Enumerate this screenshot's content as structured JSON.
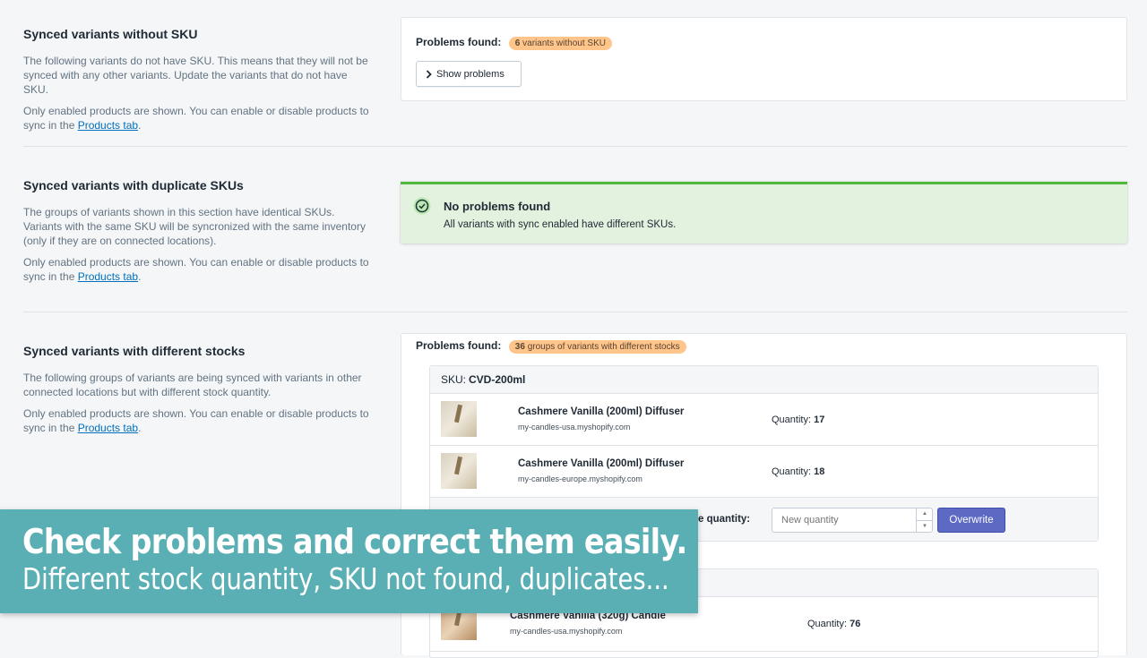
{
  "sections": [
    {
      "title": "Synced variants without SKU",
      "description": "The following variants do not have SKU. This means that they will not be synced with any other variants. Update the variants that do not have SKU.",
      "note_prefix": "Only enabled products are shown. You can enable or disable products to sync in the ",
      "link": "Products tab",
      "note_suffix": "."
    },
    {
      "title": "Synced variants with duplicate SKUs",
      "description": "The groups of variants shown in this section have identical SKUs. Variants with the same SKU will be syncronized with the same inventory (only if they are on connected locations).",
      "note_prefix": "Only enabled products are shown. You can enable or disable products to sync in the ",
      "link": "Products tab",
      "note_suffix": "."
    },
    {
      "title": "Synced variants with different stocks",
      "description": "The following groups of variants are being synced with variants in other connected locations but with different stock quantity.",
      "note_prefix": "Only enabled products are shown. You can enable or disable products to sync in the ",
      "link": "Products tab",
      "note_suffix": "."
    }
  ],
  "card_no_sku": {
    "problems_label": "Problems found:",
    "badge_count": "6",
    "badge_text": " variants without SKU",
    "button_label": "Show problems",
    "button_icon": "chevron-right-icon"
  },
  "card_duplicates": {
    "icon": "check-circle-icon",
    "title": "No problems found",
    "text": "All variants with sync enabled have different SKUs.",
    "color": "#50b83c"
  },
  "card_stocks": {
    "problems_label": "Problems found:",
    "badge_count": "36",
    "badge_text": " groups of variants with different stocks",
    "groups": [
      {
        "sku_label": "SKU: ",
        "sku": "CVD-200ml",
        "variants": [
          {
            "name": "Cashmere Vanilla (200ml) Diffuser",
            "store": "my-candles-usa.myshopify.com",
            "qty_label": "Quantity: ",
            "qty": "17"
          },
          {
            "name": "Cashmere Vanilla (200ml) Diffuser",
            "store": "my-candles-europe.myshopify.com",
            "qty_label": "Quantity: ",
            "qty": "18"
          }
        ],
        "overwrite_label": "e quantity:",
        "input_placeholder": "New quantity",
        "overwrite_button": "Overwrite"
      },
      {
        "variants": [
          {
            "name": "Cashmere Vanilla (320g) Candle",
            "store": "my-candles-usa.myshopify.com",
            "qty_label": "Quantity: ",
            "qty": "76"
          }
        ]
      }
    ]
  },
  "banner": {
    "headline": "Check problems and correct them easily.",
    "subline": "Different stock quantity, SKU not found, duplicates...",
    "color": "#5aafb4"
  },
  "colors": {
    "badge": "#ffc58b",
    "primary": "#5c6ac4",
    "link": "#006fbb"
  }
}
